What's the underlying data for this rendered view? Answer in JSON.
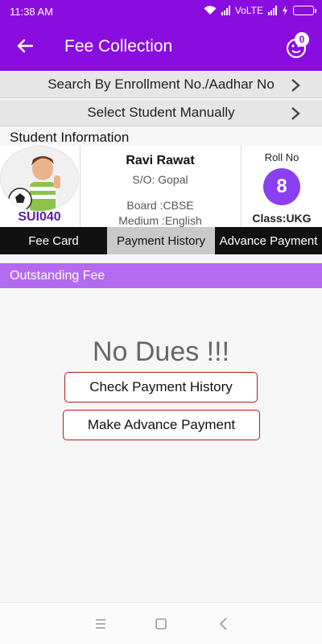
{
  "status_bar": {
    "time": "11:38 AM",
    "network": "VoLTE"
  },
  "app_bar": {
    "title": "Fee Collection",
    "notification_count": "0"
  },
  "nav_rows": [
    {
      "label": "Search By Enrollment No./Aadhar No"
    },
    {
      "label": "Select Student Manually"
    }
  ],
  "student": {
    "section_title": "Student Information",
    "enrollment": "SUI040",
    "name": "Ravi Rawat",
    "parent": "S/O: Gopal",
    "board": "Board :CBSE",
    "medium": "Medium :English",
    "roll_label": "Roll No",
    "roll_no": "8",
    "class": "Class:UKG"
  },
  "tabs": [
    {
      "label": "Fee Card",
      "selected": false
    },
    {
      "label": "Payment History",
      "selected": true
    },
    {
      "label": "Advance Payment",
      "selected": false
    }
  ],
  "outstanding": {
    "title": "Outstanding Fee",
    "message": "No Dues !!!"
  },
  "actions": {
    "check_history": "Check Payment History",
    "advance_payment": "Make Advance Payment"
  },
  "icons": [
    "back-arrow-icon",
    "notification-face-icon",
    "chevron-right-icon",
    "wifi-icon",
    "signal-icon",
    "battery-icon",
    "recents-icon",
    "home-icon",
    "system-back-icon"
  ],
  "colors": {
    "primary": "#8a0de0",
    "accent": "#b46af0",
    "button_border": "#b71c1c"
  }
}
